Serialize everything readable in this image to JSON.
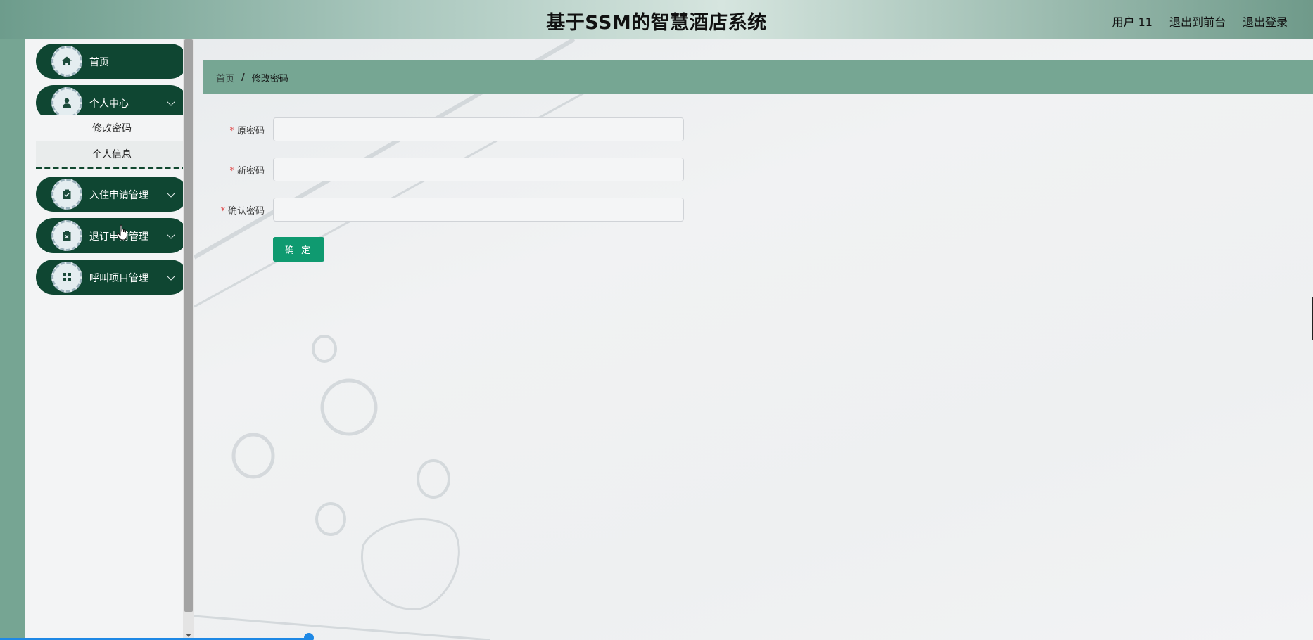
{
  "header": {
    "title": "基于SSM的智慧酒店系统",
    "links": {
      "user": "用户 11",
      "front": "退出到前台",
      "logout": "退出登录"
    }
  },
  "sidebar": {
    "items": [
      {
        "label": "首页",
        "icon": "home-icon"
      },
      {
        "label": "个人中心",
        "icon": "user-icon",
        "children": [
          {
            "label": "修改密码"
          },
          {
            "label": "个人信息"
          }
        ]
      },
      {
        "label": "入住申请管理",
        "icon": "clipboard-check-icon"
      },
      {
        "label": "退订申请管理",
        "icon": "clipboard-x-icon"
      },
      {
        "label": "呼叫项目管理",
        "icon": "grid-icon"
      }
    ]
  },
  "breadcrumb": {
    "home": "首页",
    "separator": "/",
    "current": "修改密码"
  },
  "form": {
    "fields": [
      {
        "label": "原密码",
        "required": true,
        "value": ""
      },
      {
        "label": "新密码",
        "required": true,
        "value": ""
      },
      {
        "label": "确认密码",
        "required": true,
        "value": ""
      }
    ],
    "required_mark": "*",
    "submit_label": "确 定"
  },
  "colors": {
    "sidebar_pill": "#0f4632",
    "breadcrumb_bar": "#76a693",
    "submit_button": "#0f9a70",
    "required_star": "#e04b4b"
  }
}
